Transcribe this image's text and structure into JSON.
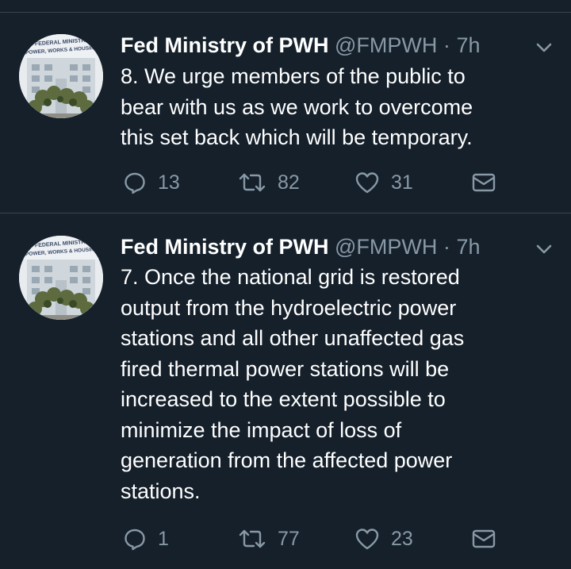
{
  "tweets": [
    {
      "name": "Fed Ministry of PWH",
      "handle": "@FMPWH",
      "separator": "·",
      "time": "7h",
      "avatar_text": [
        "FEDERAL MINISTRY",
        "POWER, WORKS & HOUSING"
      ],
      "lines": [
        "8. We urge members of the public to",
        "bear with us as we work to overcome",
        "this set back which will be temporary."
      ],
      "replies": "13",
      "retweets": "82",
      "likes": "31"
    },
    {
      "name": "Fed Ministry of PWH",
      "handle": "@FMPWH",
      "separator": "·",
      "time": "7h",
      "avatar_text": [
        "FEDERAL MINISTRY",
        "POWER, WORKS & HOUSING"
      ],
      "lines": [
        "7. Once the national grid is restored",
        "output from the hydroelectric power",
        "stations and all other unaffected gas",
        "fired thermal power stations will be",
        "increased to the extent possible to",
        "minimize the impact of loss of",
        "generation from the affected power",
        "stations."
      ],
      "replies": "1",
      "retweets": "77",
      "likes": "23"
    }
  ],
  "icons": {
    "reply": "reply-icon",
    "retweet": "retweet-icon",
    "like": "heart-icon",
    "share": "share-mail-icon",
    "caret": "chevron-down-icon"
  },
  "colors": {
    "background": "#15202b",
    "text": "#ffffff",
    "secondary": "#8899a6",
    "divider": "#38444d"
  }
}
